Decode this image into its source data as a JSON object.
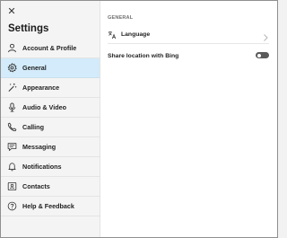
{
  "window": {
    "close_glyph": "✕"
  },
  "sidebar": {
    "title": "Settings",
    "active_item": "General",
    "items": [
      {
        "label": "Account & Profile",
        "icon": "person-icon"
      },
      {
        "label": "General",
        "icon": "gear-icon"
      },
      {
        "label": "Appearance",
        "icon": "magic-wand-icon"
      },
      {
        "label": "Audio & Video",
        "icon": "microphone-icon"
      },
      {
        "label": "Calling",
        "icon": "phone-icon"
      },
      {
        "label": "Messaging",
        "icon": "chat-bubble-icon"
      },
      {
        "label": "Notifications",
        "icon": "bell-icon"
      },
      {
        "label": "Contacts",
        "icon": "contact-card-icon"
      },
      {
        "label": "Help & Feedback",
        "icon": "question-icon"
      }
    ]
  },
  "main": {
    "section_header": "GENERAL",
    "language": {
      "label": "Language",
      "icon": "translate-icon"
    },
    "location": {
      "label": "Share location with Bing",
      "toggle_on": false
    }
  },
  "colors": {
    "active_bg": "#d3ebfa",
    "sidebar_bg": "#f4f4f4",
    "toggle_off": "#5a5a5a"
  }
}
